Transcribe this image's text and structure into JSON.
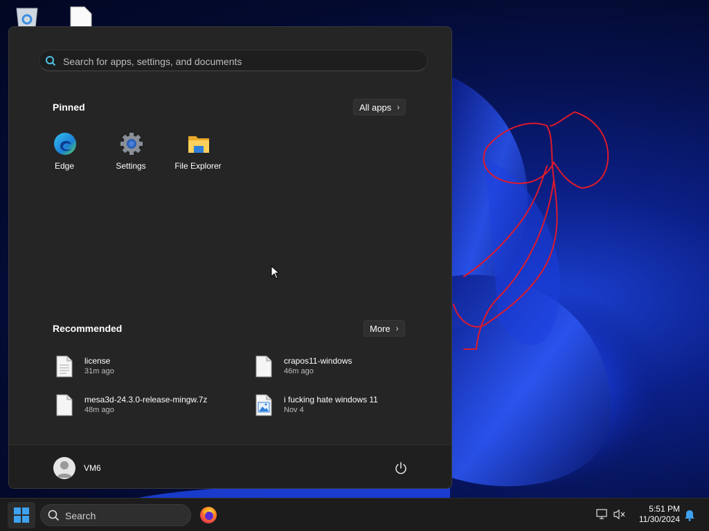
{
  "start_menu": {
    "search": {
      "placeholder": "Search for apps, settings, and documents"
    },
    "pinned": {
      "title": "Pinned",
      "all_apps_label": "All apps",
      "apps": [
        {
          "label": "Edge",
          "icon": "edge-icon"
        },
        {
          "label": "Settings",
          "icon": "settings-gear-icon"
        },
        {
          "label": "File Explorer",
          "icon": "folder-icon"
        }
      ]
    },
    "recommended": {
      "title": "Recommended",
      "more_label": "More",
      "items": [
        {
          "name": "license",
          "time": "31m ago",
          "icon": "document-icon"
        },
        {
          "name": "crapos11-windows",
          "time": "46m ago",
          "icon": "document-icon"
        },
        {
          "name": "mesa3d-24.3.0-release-mingw.7z",
          "time": "48m ago",
          "icon": "document-icon"
        },
        {
          "name": "i fucking hate windows 11",
          "time": "Nov 4",
          "icon": "image-file-icon"
        }
      ]
    },
    "footer": {
      "user_name": "VM6"
    }
  },
  "taskbar": {
    "search_label": "Search",
    "clock": {
      "time": "5:51 PM",
      "date": "11/30/2024"
    }
  },
  "colors": {
    "menu_bg": "#252525",
    "footer_bg": "#1f1f1f",
    "taskbar_bg": "#1c1c1c",
    "accent": "#0078d4",
    "scribble": "#e0192b"
  }
}
